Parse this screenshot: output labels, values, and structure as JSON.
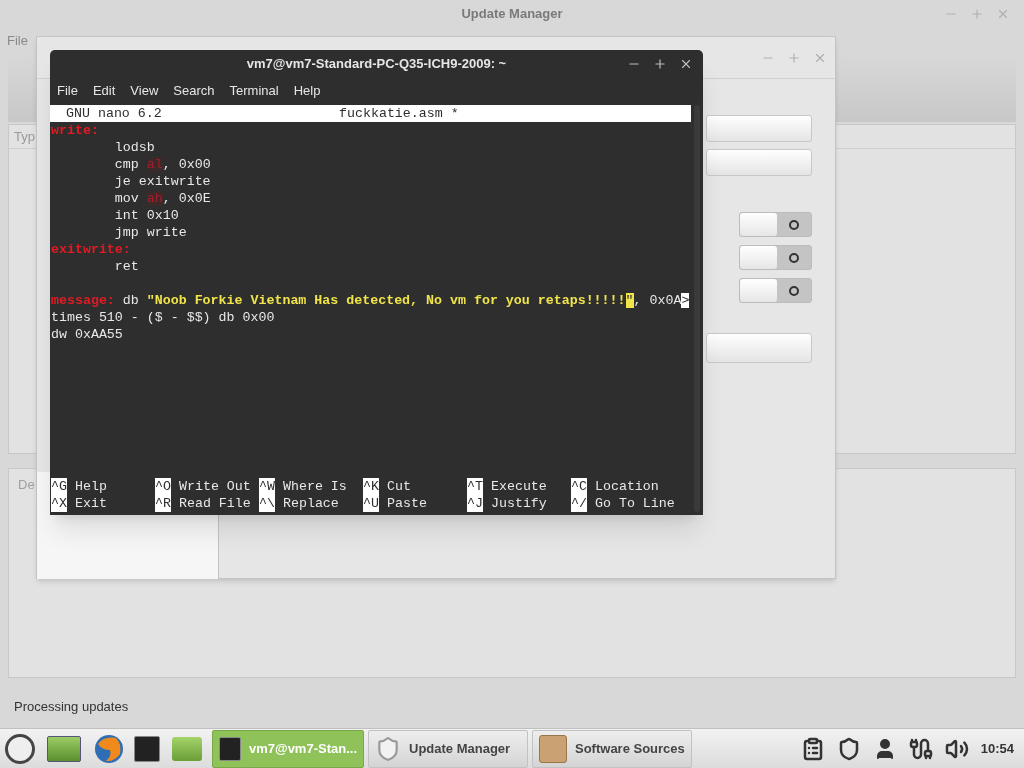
{
  "update_manager": {
    "title": "Update Manager",
    "menu": [
      "File"
    ],
    "column_header": "Typ",
    "pane_tab": "De",
    "status": "Processing updates"
  },
  "software_sources": {
    "toggles": [
      {
        "on": false
      },
      {
        "on": false
      },
      {
        "on": false
      }
    ]
  },
  "terminal": {
    "title": "vm7@vm7-Standard-PC-Q35-ICH9-2009: ~",
    "menu": [
      "File",
      "Edit",
      "View",
      "Search",
      "Terminal",
      "Help"
    ],
    "nano": {
      "version": "GNU nano 6.2",
      "filename": "fuckkatie.asm *",
      "lines": [
        {
          "kind": "code",
          "segments": [
            {
              "kind": "label",
              "text": "write:"
            }
          ]
        },
        {
          "kind": "code",
          "segments": [
            {
              "kind": "plain",
              "text": "\tlodsb"
            }
          ]
        },
        {
          "kind": "code",
          "segments": [
            {
              "kind": "plain",
              "text": "\tcmp "
            },
            {
              "kind": "register",
              "text": "al"
            },
            {
              "kind": "plain",
              "text": ", 0x00"
            }
          ]
        },
        {
          "kind": "code",
          "segments": [
            {
              "kind": "plain",
              "text": "\tje exitwrite"
            }
          ]
        },
        {
          "kind": "code",
          "segments": [
            {
              "kind": "plain",
              "text": "\tmov "
            },
            {
              "kind": "register",
              "text": "ah"
            },
            {
              "kind": "plain",
              "text": ", 0x0E"
            }
          ]
        },
        {
          "kind": "code",
          "segments": [
            {
              "kind": "plain",
              "text": "\tint 0x10"
            }
          ]
        },
        {
          "kind": "code",
          "segments": [
            {
              "kind": "plain",
              "text": "\tjmp write"
            }
          ]
        },
        {
          "kind": "code",
          "segments": [
            {
              "kind": "label",
              "text": "exitwrite:"
            }
          ]
        },
        {
          "kind": "code",
          "segments": [
            {
              "kind": "plain",
              "text": "\tret"
            }
          ]
        },
        {
          "kind": "blank"
        },
        {
          "kind": "code",
          "segments": [
            {
              "kind": "label",
              "text": "message:"
            },
            {
              "kind": "plain",
              "text": " db "
            },
            {
              "kind": "string",
              "text": "\"Noob Forkie Vietnam Has detected, No vm for you retaps!!!!!"
            },
            {
              "kind": "cursor",
              "text": "\""
            },
            {
              "kind": "plain",
              "text": ", 0x0A"
            },
            {
              "kind": "overflow",
              "text": ">"
            }
          ]
        },
        {
          "kind": "code",
          "segments": [
            {
              "kind": "plain",
              "text": "times 510 - ($ - $$) db 0x00"
            }
          ]
        },
        {
          "kind": "code",
          "segments": [
            {
              "kind": "plain",
              "text": "dw 0xAA55"
            }
          ]
        }
      ],
      "shortcuts": [
        [
          {
            "key": "^G",
            "label": "Help"
          },
          {
            "key": "^O",
            "label": "Write Out"
          },
          {
            "key": "^W",
            "label": "Where Is"
          },
          {
            "key": "^K",
            "label": "Cut"
          },
          {
            "key": "^T",
            "label": "Execute"
          },
          {
            "key": "^C",
            "label": "Location"
          }
        ],
        [
          {
            "key": "^X",
            "label": "Exit"
          },
          {
            "key": "^R",
            "label": "Read File"
          },
          {
            "key": "^\\",
            "label": "Replace"
          },
          {
            "key": "^U",
            "label": "Paste"
          },
          {
            "key": "^J",
            "label": "Justify"
          },
          {
            "key": "^/",
            "label": "Go To Line"
          }
        ]
      ]
    }
  },
  "taskbar": {
    "windows": [
      {
        "kind": "terminal",
        "label": "vm7@vm7-Stan...",
        "selected": true
      },
      {
        "kind": "shield",
        "label": "Update Manager",
        "selected": false
      },
      {
        "kind": "package",
        "label": "Software Sources",
        "selected": false
      }
    ],
    "clock": "10:54"
  }
}
